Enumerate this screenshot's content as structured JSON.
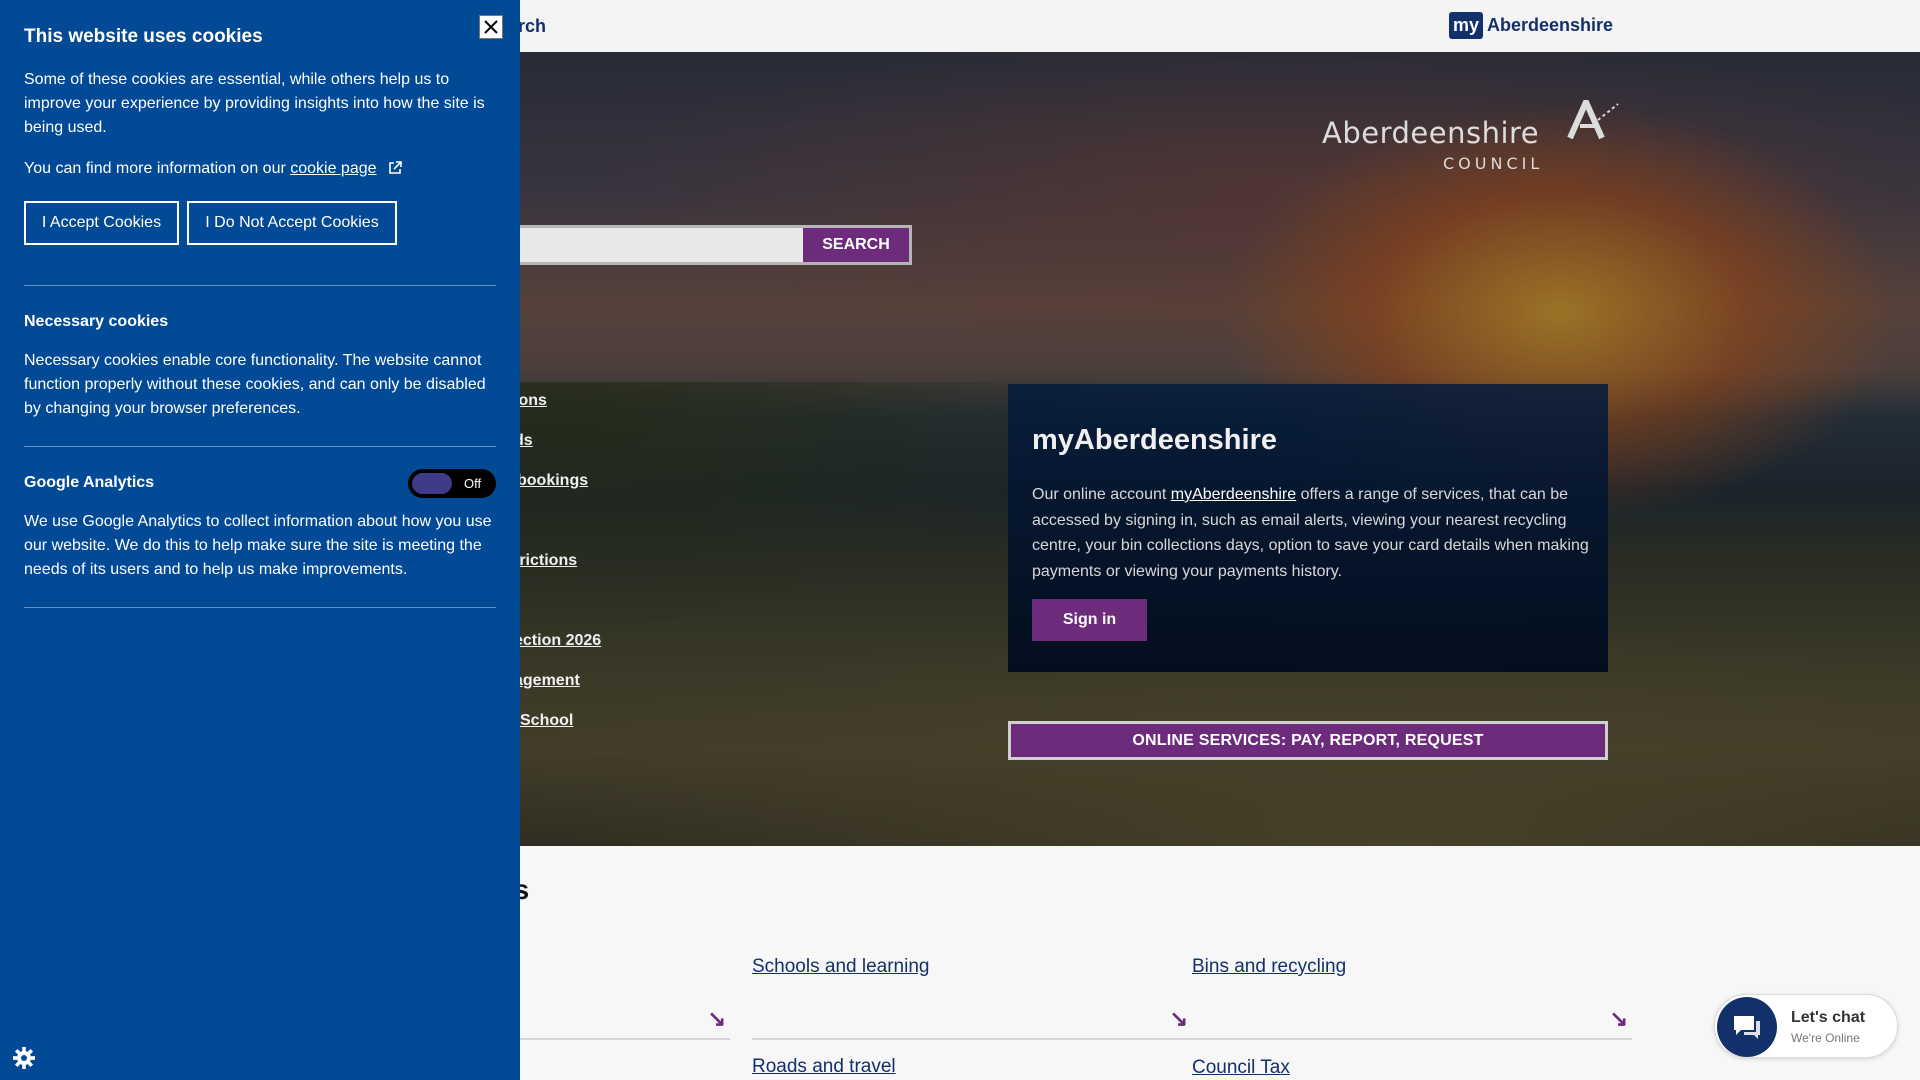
{
  "header": {
    "search_link": "arch",
    "my_badge": "my",
    "my_text": "Aberdeenshire"
  },
  "hero": {
    "logo_name": "Aberdeenshire",
    "logo_sub": "COUNCIL",
    "search_button": "SEARCH",
    "quick_links": [
      "ions",
      "ds",
      "bookings",
      "trictions",
      "ection 2026",
      "agement",
      "School"
    ],
    "my_panel": {
      "title": "myAberdeenshire",
      "text_before": "Our online account ",
      "link": "myAberdeenshire",
      "text_after": " offers a range of services, that can be accessed by signing in, such as email alerts, viewing your nearest recycling centre, your bin collections days, option to save your card details when making payments or viewing your payments history.",
      "signin": "Sign in"
    },
    "online_services": "ONLINE SERVICES: PAY, REPORT, REQUEST"
  },
  "content": {
    "heading": "es",
    "tiles": [
      "Schools and learning",
      "Bins and recycling"
    ],
    "tiles_row2": [
      "Roads and travel",
      "Council Tax"
    ]
  },
  "chat": {
    "title": "Let's chat",
    "status": "We're Online"
  },
  "cookie": {
    "title": "This website uses cookies",
    "intro": "Some of these cookies are essential, while others help us to improve your experience by providing insights into how the site is being used.",
    "more_info": "You can find more information on our ",
    "more_info_link": "cookie page",
    "accept": "I Accept Cookies",
    "reject": "I Do Not Accept Cookies",
    "necessary_title": "Necessary cookies",
    "necessary_text": "Necessary cookies enable core functionality. The website cannot function properly without these cookies, and can only be disabled by changing your browser preferences.",
    "analytics_title": "Google Analytics",
    "analytics_toggle": "Off",
    "analytics_text": "We use Google Analytics to collect information about how you use our website. We do this to help make sure the site is meeting the needs of its users and to help us make improvements."
  },
  "colors": {
    "cookie_panel": "#034a96",
    "brand_purple": "#6c2b7b",
    "brand_navy": "#12306a"
  }
}
